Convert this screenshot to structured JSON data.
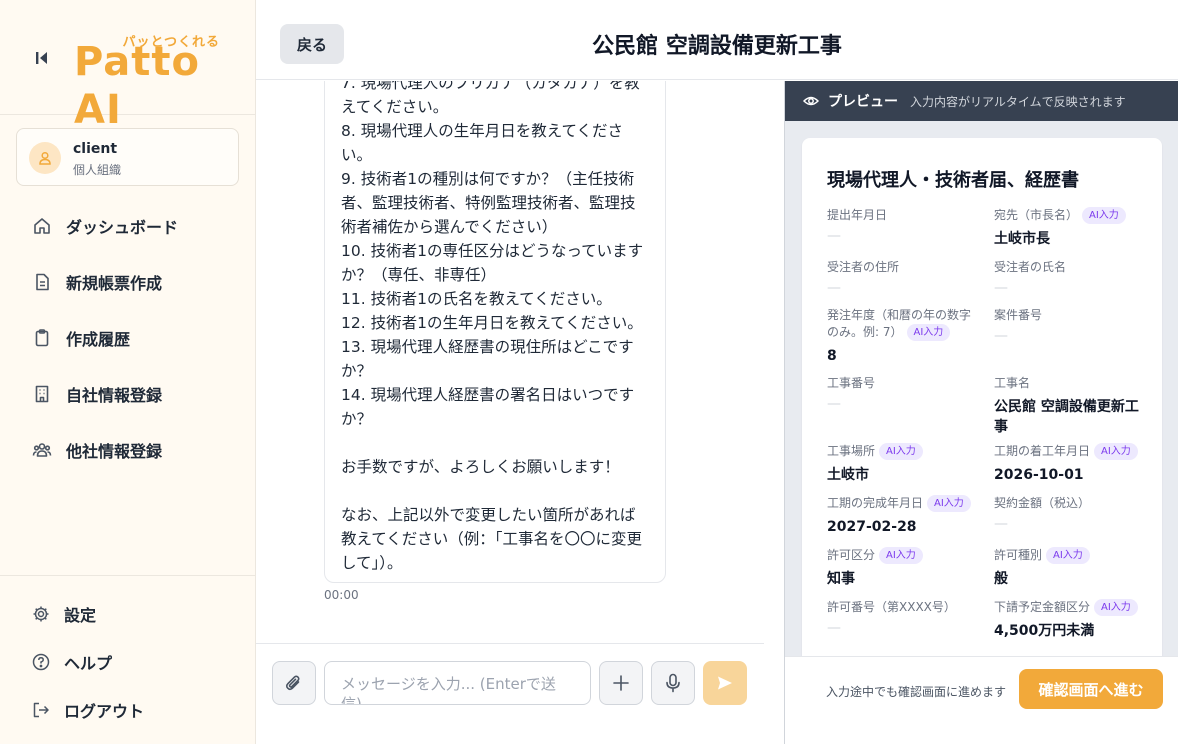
{
  "logo": {
    "tagline": "パッとつくれる",
    "name": "Patto AI"
  },
  "account": {
    "name": "client",
    "type": "個人組織"
  },
  "nav": [
    {
      "label": "ダッシュボード",
      "icon": "home-icon"
    },
    {
      "label": "新規帳票作成",
      "icon": "document-icon"
    },
    {
      "label": "作成履歴",
      "icon": "clipboard-icon"
    },
    {
      "label": "自社情報登録",
      "icon": "building-icon"
    },
    {
      "label": "他社情報登録",
      "icon": "users-icon"
    }
  ],
  "footer_nav": [
    {
      "label": "設定",
      "icon": "gear-icon"
    },
    {
      "label": "ヘルプ",
      "icon": "help-icon"
    },
    {
      "label": "ログアウト",
      "icon": "logout-icon"
    }
  ],
  "header": {
    "back_label": "戻る",
    "title": "公民館 空調設備更新工事"
  },
  "chat": {
    "message": "7. 現場代理人のフリガナ（カタカナ）を教えてください。\n8. 現場代理人の生年月日を教えてください。\n9. 技術者1の種別は何ですか？（主任技術者、監理技術者、特例監理技術者、監理技術者補佐から選んでください）\n10. 技術者1の専任区分はどうなっていますか？（専任、非専任）\n11. 技術者1の氏名を教えてください。\n12. 技術者1の生年月日を教えてください。\n13. 現場代理人経歴書の現住所はどこですか？\n14. 現場代理人経歴書の署名日はいつですか？\n\nお手数ですが、よろしくお願いします！\n\nなお、上記以外で変更したい箇所があれば教えてください（例：「工事名を〇〇に変更して」）。",
    "timestamp": "00:00",
    "input_placeholder": "メッセージを入力... (Enterで送信)"
  },
  "preview": {
    "bar_title": "プレビュー",
    "bar_subtitle": "入力内容がリアルタイムで反映されます",
    "doc_title": "現場代理人・技術者届、経歴書",
    "ai_badge": "AI入力",
    "empty_mark": "—",
    "fields": {
      "submit_date": {
        "label": "提出年月日",
        "value": ""
      },
      "addressee": {
        "label": "宛先（市長名）",
        "value": "土岐市長"
      },
      "contractor_address": {
        "label": "受注者の住所",
        "value": ""
      },
      "contractor_name": {
        "label": "受注者の氏名",
        "value": ""
      },
      "order_year": {
        "label": "発注年度（和暦の年の数字のみ。例: 7）",
        "value": "8"
      },
      "case_number": {
        "label": "案件番号",
        "value": ""
      },
      "work_number": {
        "label": "工事番号",
        "value": ""
      },
      "work_name": {
        "label": "工事名",
        "value": "公民館 空調設備更新工事"
      },
      "work_place": {
        "label": "工事場所",
        "value": "土岐市"
      },
      "start_date": {
        "label": "工期の着工年月日",
        "value": "2026-10-01"
      },
      "end_date": {
        "label": "工期の完成年月日",
        "value": "2027-02-28"
      },
      "contract_amount": {
        "label": "契約金額（税込）",
        "value": ""
      },
      "permit_class": {
        "label": "許可区分",
        "value": "知事"
      },
      "permit_type": {
        "label": "許可種別",
        "value": "般"
      },
      "permit_number": {
        "label": "許可番号（第XXXX号）",
        "value": ""
      },
      "subcontract_class": {
        "label": "下請予定金額区分",
        "value": "4,500万円未満"
      }
    },
    "footer_hint": "入力途中でも確認画面に進めます",
    "confirm_label": "確認画面へ進む"
  }
}
